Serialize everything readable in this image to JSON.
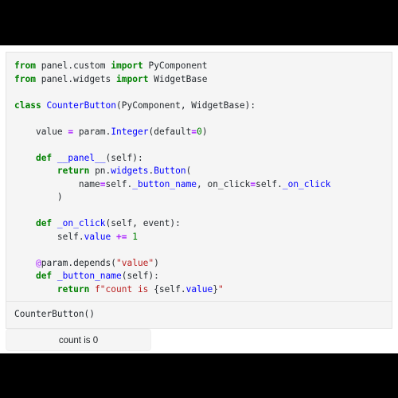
{
  "window": {
    "background_color": "#000000",
    "page_background_color": "#ffffff"
  },
  "notebook": {
    "code_cell": {
      "language": "python",
      "background_color": "#f5f5f5",
      "lines": [
        "from panel.custom import PyComponent",
        "from panel.widgets import WidgetBase",
        "",
        "class CounterButton(PyComponent, WidgetBase):",
        "",
        "    value = param.Integer(default=0)",
        "",
        "    def __panel__(self):",
        "        return pn.widgets.Button(",
        "            name=self._button_name, on_click=self._on_click",
        "        )",
        "",
        "    def _on_click(self, event):",
        "        self.value += 1",
        "",
        "    @param.depends(\"value\")",
        "    def _button_name(self):",
        "        return f\"count is {self.value}\""
      ]
    },
    "output_cell": {
      "text": "CounterButton()",
      "background_color": "#f5f5f5"
    }
  },
  "widget": {
    "counter_button": {
      "label": "count is 0",
      "count": 0,
      "background_color": "#f5f5f5",
      "text_color": "#212529"
    }
  },
  "syntax_colors": {
    "keyword": "#008000",
    "class_name": "#0000ff",
    "operator": "#aa22ff",
    "string": "#ba2121",
    "number": "#008000",
    "decorator": "#aa22ff",
    "plain": "#24292e"
  }
}
